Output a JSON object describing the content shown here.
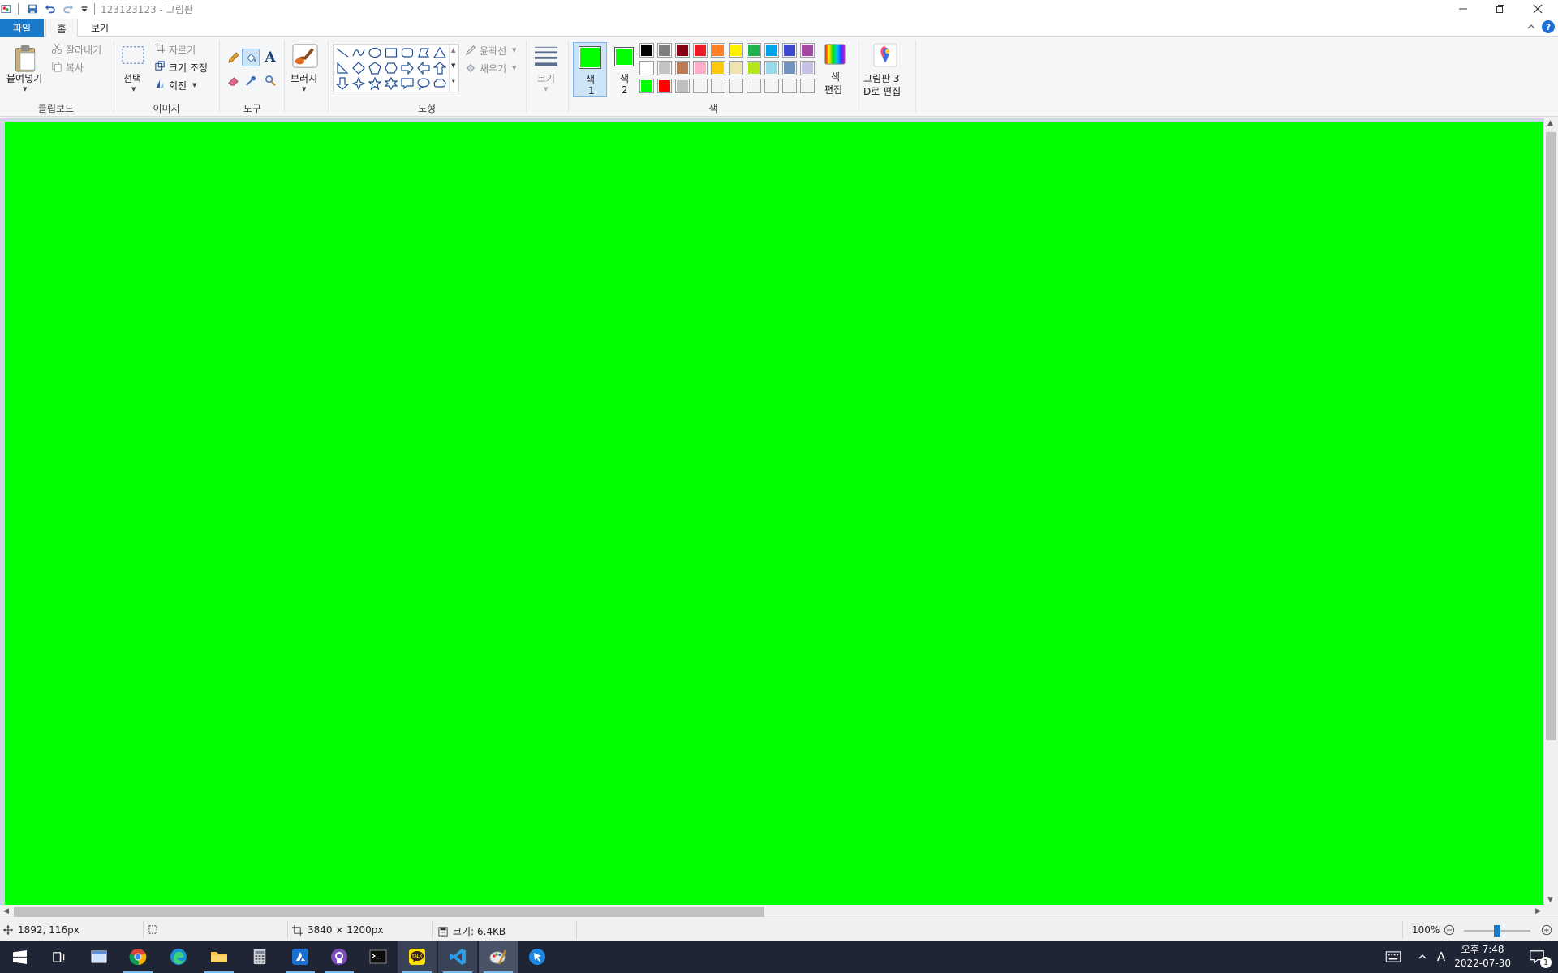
{
  "window": {
    "title": "123123123 - 그림판"
  },
  "menu": {
    "file": "파일",
    "home": "홈",
    "view": "보기",
    "help": "?"
  },
  "ribbon": {
    "clipboard": {
      "paste": "붙여넣기",
      "cut": "잘라내기",
      "copy": "복사",
      "label": "클립보드"
    },
    "image": {
      "select": "선택",
      "crop": "자르기",
      "resize": "크기 조정",
      "rotate": "회전",
      "label": "이미지"
    },
    "tools": {
      "label": "도구",
      "text_tool": "A"
    },
    "brushes": {
      "label": "브러시"
    },
    "shapes": {
      "outline": "윤곽선",
      "fill": "채우기",
      "label": "도형"
    },
    "size": {
      "label": "크기"
    },
    "colors": {
      "color1_a": "색",
      "color1_b": "1",
      "color2_a": "색",
      "color2_b": "2",
      "edit_a": "색",
      "edit_b": "편집",
      "label": "색",
      "color1": "#00ff00",
      "color2": "#00ff00",
      "palette": [
        "#000000",
        "#7f7f7f",
        "#880015",
        "#ed1c24",
        "#ff7f27",
        "#fff200",
        "#22b14c",
        "#00a2e8",
        "#3f48cc",
        "#a349a4",
        "#ffffff",
        "#c3c3c3",
        "#b97a57",
        "#ffaec9",
        "#ffc90e",
        "#efe4b0",
        "#b5e61d",
        "#99d9ea",
        "#7092be",
        "#c8bfe7",
        "#00ff00",
        "#ff0000",
        "#c0c0c0",
        "#f4f4f4",
        "#f4f4f4",
        "#f4f4f4",
        "#f4f4f4",
        "#f4f4f4",
        "#f4f4f4",
        "#f4f4f4"
      ]
    },
    "paint3d": {
      "line1": "그림판 3",
      "line2": "D로 편집"
    }
  },
  "canvas": {
    "fill_color": "#00ff00"
  },
  "status": {
    "cursor_pos": "1892, 116px",
    "image_size": "3840 × 1200px",
    "file_size": "크기: 6.4KB",
    "zoom": "100%",
    "zoom_level": 0.5
  },
  "taskbar": {
    "apps": [
      "start-icon",
      "task-view-icon",
      "window-icon",
      "chrome-icon",
      "edge-icon",
      "file-explorer-icon",
      "calculator-icon",
      "azure-icon",
      "github-icon",
      "terminal-icon",
      "kakaotalk-icon",
      "vscode-icon",
      "paint-icon",
      "cursor-app-icon"
    ],
    "ime": "A",
    "time": "오후 7:48",
    "date": "2022-07-30",
    "notifications": "1"
  }
}
